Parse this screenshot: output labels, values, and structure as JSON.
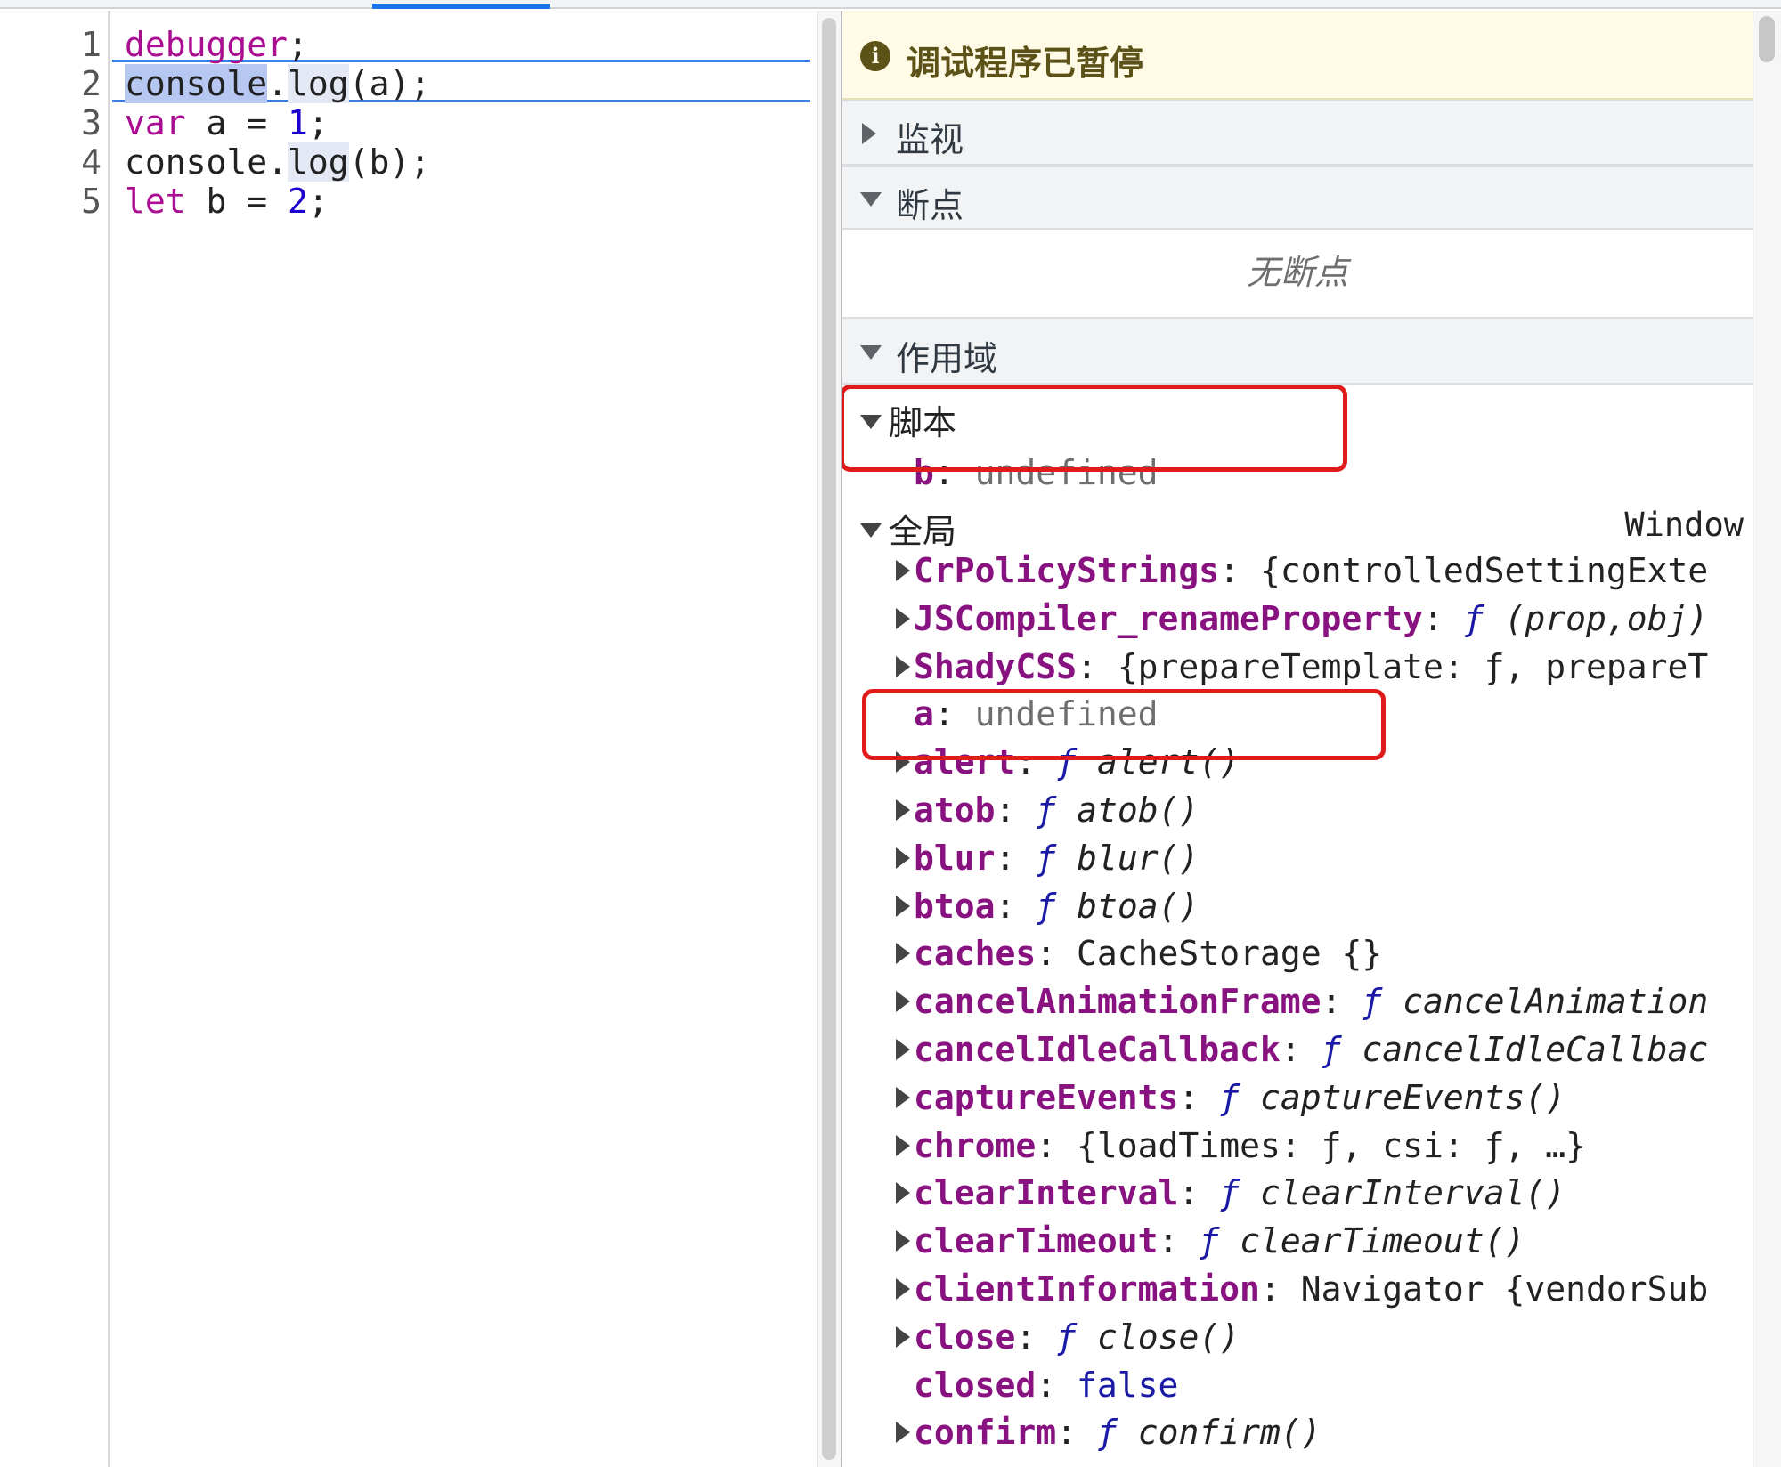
{
  "editor": {
    "line_numbers": [
      "1",
      "2",
      "3",
      "4",
      "5"
    ]
  },
  "paused": {
    "icon": "info-icon",
    "message": "调试程序已暂停"
  },
  "sections": {
    "watch": "监视",
    "breakpoints": "断点",
    "no_breakpoints": "无断点",
    "scope": "作用域"
  },
  "scope": {
    "script_label": "脚本",
    "script_vars": [
      {
        "name": "b",
        "value": "undefined"
      }
    ],
    "global_label": "全局",
    "global_type": "Window",
    "global_props": [
      {
        "name": "CrPolicyStrings",
        "value": "{controlledSettingExte",
        "expandable": true
      },
      {
        "name": "JSCompiler_renameProperty",
        "fsym": "ƒ",
        "value": "(prop,obj)",
        "expandable": true
      },
      {
        "name": "ShadyCSS",
        "value": "{prepareTemplate: ƒ, prepareT",
        "expandable": true
      },
      {
        "name": "a",
        "value": "undefined",
        "expandable": false
      },
      {
        "name": "alert",
        "fsym": "ƒ",
        "value": "alert()",
        "expandable": true
      },
      {
        "name": "atob",
        "fsym": "ƒ",
        "value": "atob()",
        "expandable": true
      },
      {
        "name": "blur",
        "fsym": "ƒ",
        "value": "blur()",
        "expandable": true
      },
      {
        "name": "btoa",
        "fsym": "ƒ",
        "value": "btoa()",
        "expandable": true
      },
      {
        "name": "caches",
        "value": "CacheStorage {}",
        "expandable": true
      },
      {
        "name": "cancelAnimationFrame",
        "fsym": "ƒ",
        "value": "cancelAnimation",
        "expandable": true
      },
      {
        "name": "cancelIdleCallback",
        "fsym": "ƒ",
        "value": "cancelIdleCallbac",
        "expandable": true
      },
      {
        "name": "captureEvents",
        "fsym": "ƒ",
        "value": "captureEvents()",
        "expandable": true
      },
      {
        "name": "chrome",
        "value": "{loadTimes: ƒ, csi: ƒ, …}",
        "expandable": true
      },
      {
        "name": "clearInterval",
        "fsym": "ƒ",
        "value": "clearInterval()",
        "expandable": true
      },
      {
        "name": "clearTimeout",
        "fsym": "ƒ",
        "value": "clearTimeout()",
        "expandable": true
      },
      {
        "name": "clientInformation",
        "value": "Navigator {vendorSub",
        "expandable": true
      },
      {
        "name": "close",
        "fsym": "ƒ",
        "value": "close()",
        "expandable": true
      },
      {
        "name": "closed",
        "value": "false",
        "expandable": false
      },
      {
        "name": "confirm",
        "fsym": "ƒ",
        "value": "confirm()",
        "expandable": true
      }
    ]
  },
  "code": {
    "l1": {
      "a": "debugger",
      "b": ";"
    },
    "l2": {
      "a": "console",
      "b": ".",
      "c": "log",
      "d": "(a);"
    },
    "l3": {
      "a": "var",
      "b": " a = ",
      "c": "1",
      "d": ";"
    },
    "l4": {
      "a": "console.",
      "b": "log",
      "c": "(b);"
    },
    "l5": {
      "a": "let",
      "b": " b = ",
      "c": "2",
      "d": ";"
    }
  },
  "colors": {
    "highlight_box": "#e01b1b",
    "paused_bg": "#fffbe6",
    "property_name": "#881280",
    "keyword": "#aa0d91",
    "number": "#1c00cf"
  }
}
